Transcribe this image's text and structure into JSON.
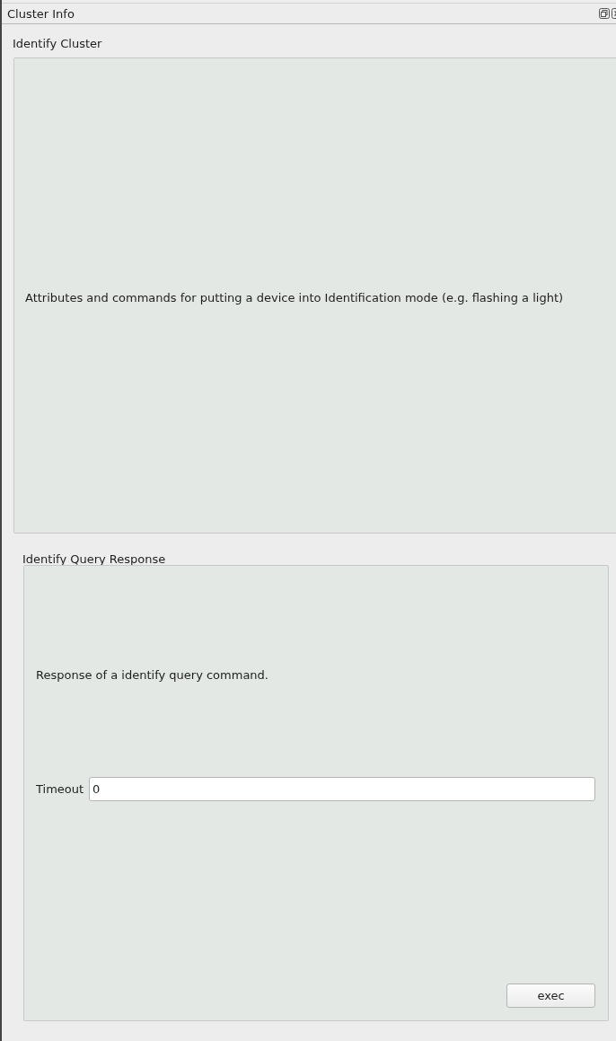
{
  "window": {
    "title": "Cluster Info"
  },
  "cluster": {
    "title": "Identify Cluster",
    "description": "Attributes and commands for putting a device into Identification mode (e.g. flashing a light)"
  },
  "command": {
    "title": "Identify Query Response",
    "description": "Response of a identify query command.",
    "fields": [
      {
        "label": "Timeout",
        "value": "0"
      }
    ],
    "button": "exec"
  }
}
